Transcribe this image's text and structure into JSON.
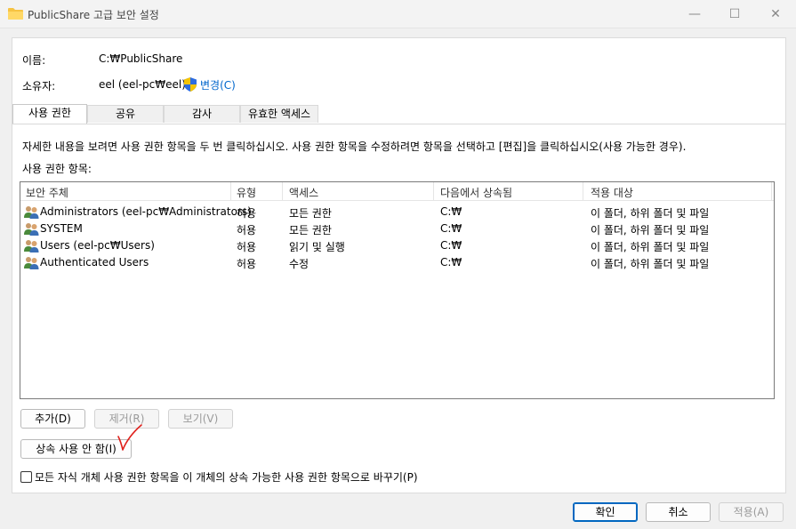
{
  "window": {
    "title": "PublicShare 고급 보안 설정",
    "minimize": "—",
    "maximize": "☐",
    "close": "✕"
  },
  "info": {
    "name_label": "이름:",
    "name_value": "C:₩PublicShare",
    "owner_label": "소유자:",
    "owner_value": "eel (eel-pc₩eel)",
    "change_link": "변경(C)"
  },
  "tabs": [
    "사용 권한",
    "공유",
    "감사",
    "유효한 액세스"
  ],
  "description": "자세한 내용을 보려면 사용 권한 항목을 두 번 클릭하십시오. 사용 권한 항목을 수정하려면 항목을 선택하고 [편집]을 클릭하십시오(사용 가능한 경우).",
  "list_label": "사용 권한 항목:",
  "columns": [
    "보안 주체",
    "유형",
    "액세스",
    "다음에서 상속됨",
    "적용 대상"
  ],
  "rows": [
    {
      "principal": "Administrators (eel-pc₩Administrators)",
      "type": "허용",
      "access": "모든 권한",
      "inherited": "C:₩",
      "applies": "이 폴더, 하위 폴더 및 파일"
    },
    {
      "principal": "SYSTEM",
      "type": "허용",
      "access": "모든 권한",
      "inherited": "C:₩",
      "applies": "이 폴더, 하위 폴더 및 파일"
    },
    {
      "principal": "Users (eel-pc₩Users)",
      "type": "허용",
      "access": "읽기 및 실행",
      "inherited": "C:₩",
      "applies": "이 폴더, 하위 폴더 및 파일"
    },
    {
      "principal": "Authenticated Users",
      "type": "허용",
      "access": "수정",
      "inherited": "C:₩",
      "applies": "이 폴더, 하위 폴더 및 파일"
    }
  ],
  "buttons": {
    "add": "추가(D)",
    "remove": "제거(R)",
    "view": "보기(V)",
    "disable_inheritance": "상속 사용 안 함(I)",
    "ok": "확인",
    "cancel": "취소",
    "apply": "적용(A)"
  },
  "replace_checkbox": {
    "label": "모든 자식 개체 사용 권한 항목을 이 개체의 상속 가능한 사용 권한 항목으로 바꾸기(P)",
    "checked": false
  },
  "icons": {
    "title": "folder-icon",
    "shield": "uac-shield-icon",
    "principal": "users-group-icon"
  },
  "colors": {
    "link": "#0066cc",
    "accent": "#0067c0",
    "annotation": "#e0201b"
  }
}
